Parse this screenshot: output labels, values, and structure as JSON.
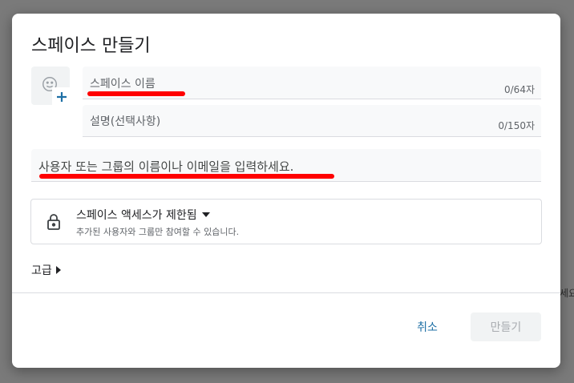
{
  "background": {
    "side_text": "세요"
  },
  "dialog": {
    "title": "스페이스 만들기",
    "name_field": {
      "placeholder": "스페이스 이름",
      "counter": "0/64자"
    },
    "description_field": {
      "placeholder": "설명(선택사항)",
      "counter": "0/150자"
    },
    "members_field": {
      "placeholder": "사용자 또는 그룹의 이름이나 이메일을 입력하세요."
    },
    "access": {
      "title": "스페이스 액세스가 제한됨",
      "subtitle": "추가된 사용자와 그룹만 참여할 수 있습니다."
    },
    "advanced_label": "고급",
    "cancel_label": "취소",
    "create_label": "만들기"
  },
  "colors": {
    "annotation": "#ff0000",
    "link": "#1d6fa5",
    "disabled_button": "#f1f3f4"
  },
  "icons": [
    "emoji-icon",
    "plus-icon",
    "lock-icon",
    "caret-down-icon",
    "caret-right-icon"
  ]
}
